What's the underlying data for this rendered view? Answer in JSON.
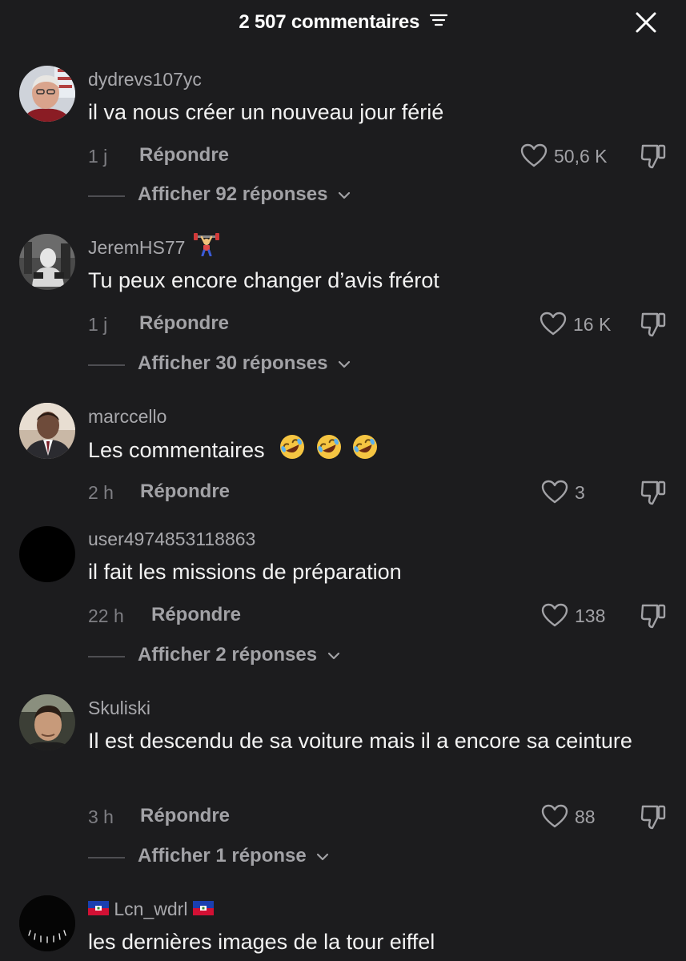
{
  "header": {
    "title": "2 507 commentaires"
  },
  "comments": [
    {
      "username": "dydrevs107yc",
      "text": "il va nous créer un nouveau jour férié",
      "time": "1 j",
      "reply_label": "Répondre",
      "likes": "50,6 K",
      "replies_label": "Afficher 92 réponses"
    },
    {
      "username": "JeremHS77",
      "text": "Tu peux encore changer d’avis frérot",
      "time": "1 j",
      "reply_label": "Répondre",
      "likes": "16 K",
      "replies_label": "Afficher 30 réponses"
    },
    {
      "username": "marccello",
      "text": "Les commentaires",
      "time": "2 h",
      "reply_label": "Répondre",
      "likes": "3"
    },
    {
      "username": "user4974853118863",
      "text": "il fait les missions de préparation",
      "time": "22 h",
      "reply_label": "Répondre",
      "likes": "138",
      "replies_label": "Afficher 2 réponses"
    },
    {
      "username": "Skuliski",
      "text": "Il est descendu de sa voiture mais il a encore sa ceinture",
      "time": "3 h",
      "reply_label": "Répondre",
      "likes": "88",
      "replies_label": "Afficher 1 réponse"
    },
    {
      "username": "Lcn_wdrl",
      "text": "les dernières images de la tour eiffel"
    }
  ],
  "colors": {
    "background": "#1c1c1e",
    "primary_text": "#f2f2f2",
    "secondary_text": "#a2a2a6"
  },
  "icons": {
    "sort": "sort-lines-icon",
    "close": "close-icon",
    "like": "heart-outline-icon",
    "dislike": "thumbs-down-icon",
    "expand": "chevron-down-icon",
    "emoji_laugh": "rolling-laughing-emoji",
    "emoji_weightlifter": "weightlifter-emoji",
    "flag": "haiti-flag-icon"
  }
}
